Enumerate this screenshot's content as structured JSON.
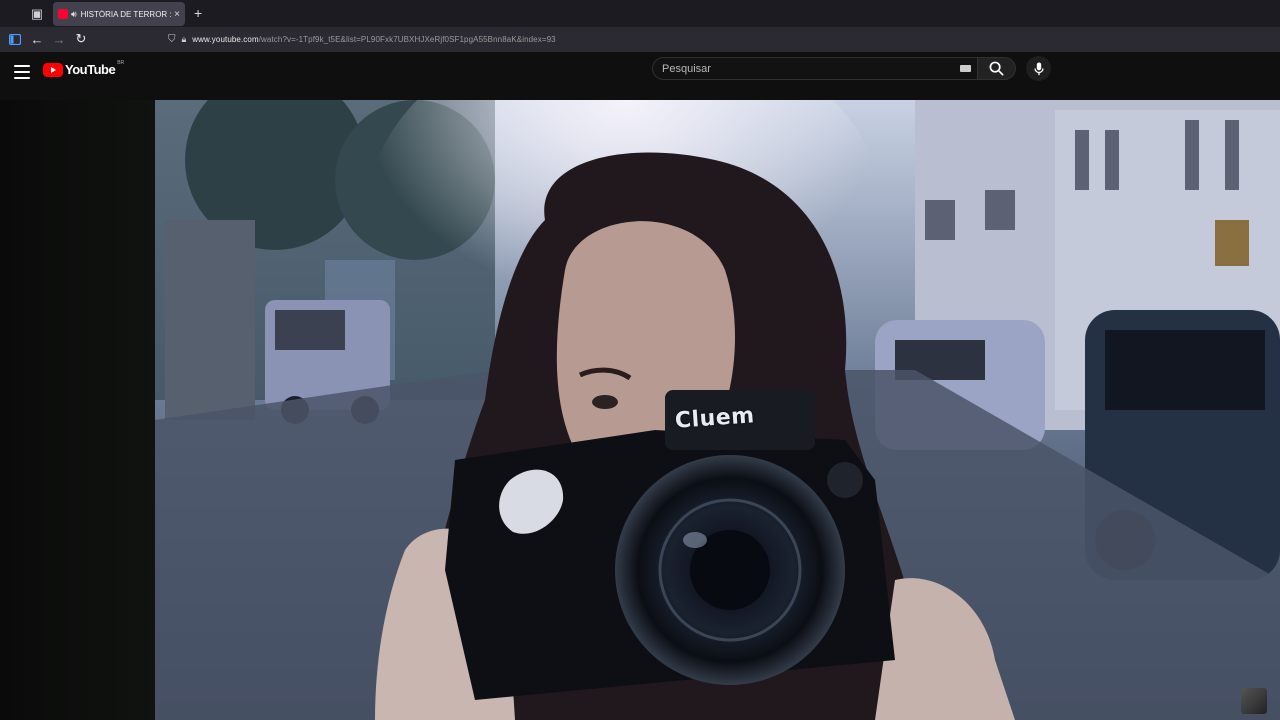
{
  "browser": {
    "tab": {
      "title": "HISTÓRIA DE TERROR : A C",
      "audio_icon": "speaker-icon",
      "close": "×"
    },
    "new_tab": "+",
    "url": {
      "domain": "www.youtube.com",
      "path": "/watch?v=-1Tpf9k_t5E&list=PL90Fxk7UBXHJXeRjf0SF1pgA55Bnn8aK&index=93"
    }
  },
  "youtube": {
    "logo_text": "YouTube",
    "country": "BR",
    "search_placeholder": "Pesquisar"
  },
  "video": {
    "camera_text": "Cluem"
  }
}
